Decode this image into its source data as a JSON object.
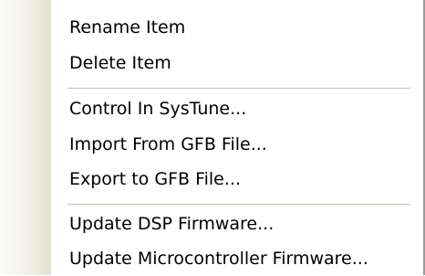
{
  "context_menu": {
    "groups": [
      {
        "items": [
          {
            "label": "Rename Item"
          },
          {
            "label": "Delete Item"
          }
        ]
      },
      {
        "items": [
          {
            "label": "Control In SysTune..."
          },
          {
            "label": "Import From GFB File..."
          },
          {
            "label": "Export to GFB File..."
          }
        ]
      },
      {
        "items": [
          {
            "label": "Update DSP Firmware..."
          },
          {
            "label": "Update Microcontroller Firmware..."
          }
        ]
      }
    ]
  }
}
